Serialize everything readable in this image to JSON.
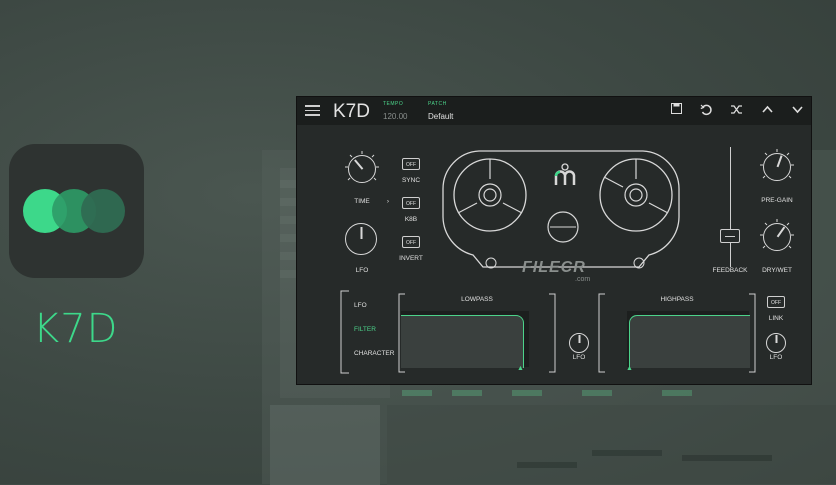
{
  "app": {
    "name": "K7D"
  },
  "brand_colors": {
    "accent": "#3dd88a",
    "circle1": "#3dd88a",
    "circle2": "#2d9b67",
    "circle3": "#2f6b52"
  },
  "plugin": {
    "title": "K7D",
    "tempo": {
      "label": "TEMPO",
      "value": "120.00"
    },
    "patch": {
      "label": "PATCH",
      "value": "Default"
    },
    "toolbar": {
      "save_icon": "save-icon",
      "undo_icon": "undo-icon",
      "shuffle_icon": "shuffle-icon",
      "prev_icon": "chevron-up-icon",
      "next_icon": "chevron-down-icon"
    },
    "time": {
      "label": "TIME",
      "level": 0.35
    },
    "lfo": {
      "label": "LFO",
      "level": 0.55
    },
    "sync": {
      "toggle": "OFF",
      "label": "SYNC"
    },
    "k8b": {
      "toggle": "OFF",
      "label": "K8B"
    },
    "invert": {
      "toggle": "OFF",
      "label": "INVERT"
    },
    "feedback": {
      "label": "FEEDBACK",
      "level": 0.3
    },
    "pre_gain": {
      "label": "PRE-GAIN",
      "level": 0.6
    },
    "dry_wet": {
      "label": "DRY/WET",
      "level": 0.7
    },
    "modes": [
      "LFO",
      "FILTER",
      "CHARACTER"
    ],
    "active_mode": "FILTER",
    "lowpass": {
      "label": "LOWPASS"
    },
    "highpass": {
      "label": "HIGHPASS"
    },
    "filter_lfo_label": "LFO",
    "link": {
      "toggle": "OFF",
      "label": "LINK"
    },
    "highpass_lfo_label": "LFO"
  },
  "watermark": {
    "text": "FILECR",
    "sub": ".com"
  }
}
